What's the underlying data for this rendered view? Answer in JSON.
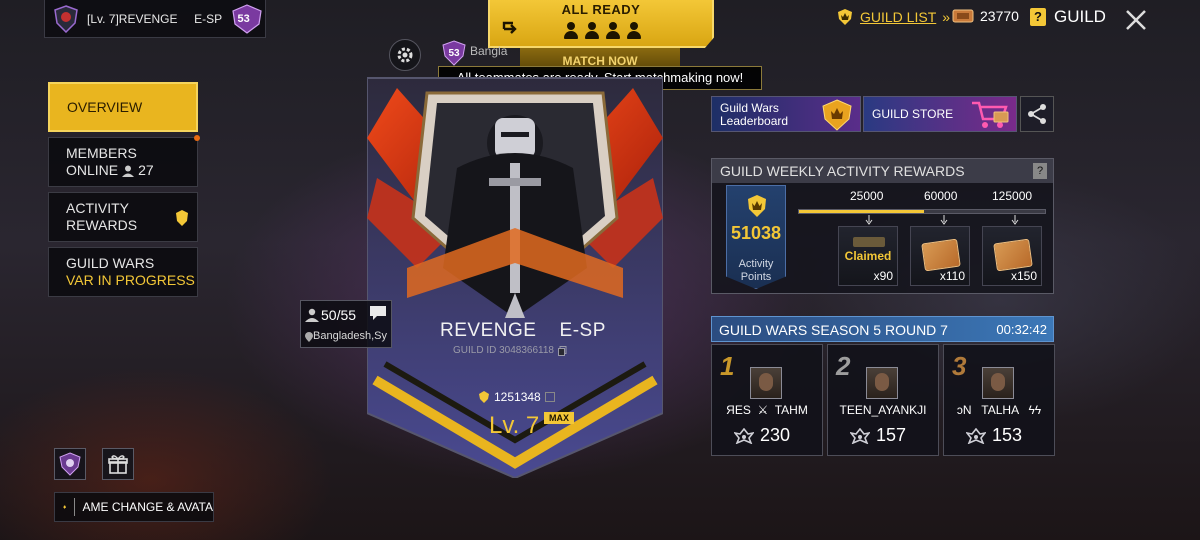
{
  "player": {
    "name": "[Lv. 7]REVENGE     E-SP",
    "level_badge": "53"
  },
  "top": {
    "all_ready": "ALL READY",
    "match_now": "MATCH NOW",
    "tooltip": "All teammates are ready. Start matchmaking now!",
    "level_badge": "53",
    "region_partial": "Bangla"
  },
  "header": {
    "guild_list": "GUILD LIST",
    "guild_list_arrows": "»",
    "currency_amount": "23770",
    "help": "?",
    "title": "GUILD"
  },
  "nav": {
    "overview": "OVERVIEW",
    "members_line1": "MEMBERS",
    "members_line2": "ONLINE",
    "members_online": "27",
    "activity_line1": "ACTIVITY",
    "activity_line2": "REWARDS",
    "wars_line1": "GUILD WARS",
    "wars_line2": "VAR IN PROGRESS"
  },
  "guild": {
    "name": "REVENGE    E-SP",
    "id_label": "GUILD ID 3048366118",
    "members": "50/55",
    "location": "Bangladesh,Sy",
    "glory": "1251348",
    "level": "Lv. 7",
    "max_label": "MAX"
  },
  "promos": {
    "leaderboard_line1": "Guild Wars",
    "leaderboard_line2": "Leaderboard",
    "store": "GUILD STORE"
  },
  "weekly": {
    "title": "GUILD WEEKLY ACTIVITY REWARDS",
    "help": "?",
    "points": "51038",
    "points_label_line1": "Activity",
    "points_label_line2": "Points",
    "progress_fraction": 0.51,
    "milestones": [
      "25000",
      "60000",
      "125000"
    ],
    "rewards": [
      {
        "status": "Claimed",
        "qty": "x90"
      },
      {
        "qty": "x110"
      },
      {
        "qty": "x150"
      }
    ]
  },
  "wars": {
    "title": "GUILD WARS SEASON 5 ROUND 7",
    "timer": "00:32:42",
    "teams": [
      {
        "rank": "1",
        "name": "ЯES  ⚔  TAHM",
        "score": "230"
      },
      {
        "rank": "2",
        "name": "TEEN_AYANKJI",
        "score": "157"
      },
      {
        "rank": "3",
        "name": "ɔN   TALHA   ϟϟ",
        "score": "153"
      }
    ]
  },
  "notice": {
    "text": "AME CHANGE & AVATA"
  },
  "colors": {
    "accent": "#f3c737",
    "panel": "#14141c",
    "wars_blue": "#3c78b8"
  }
}
